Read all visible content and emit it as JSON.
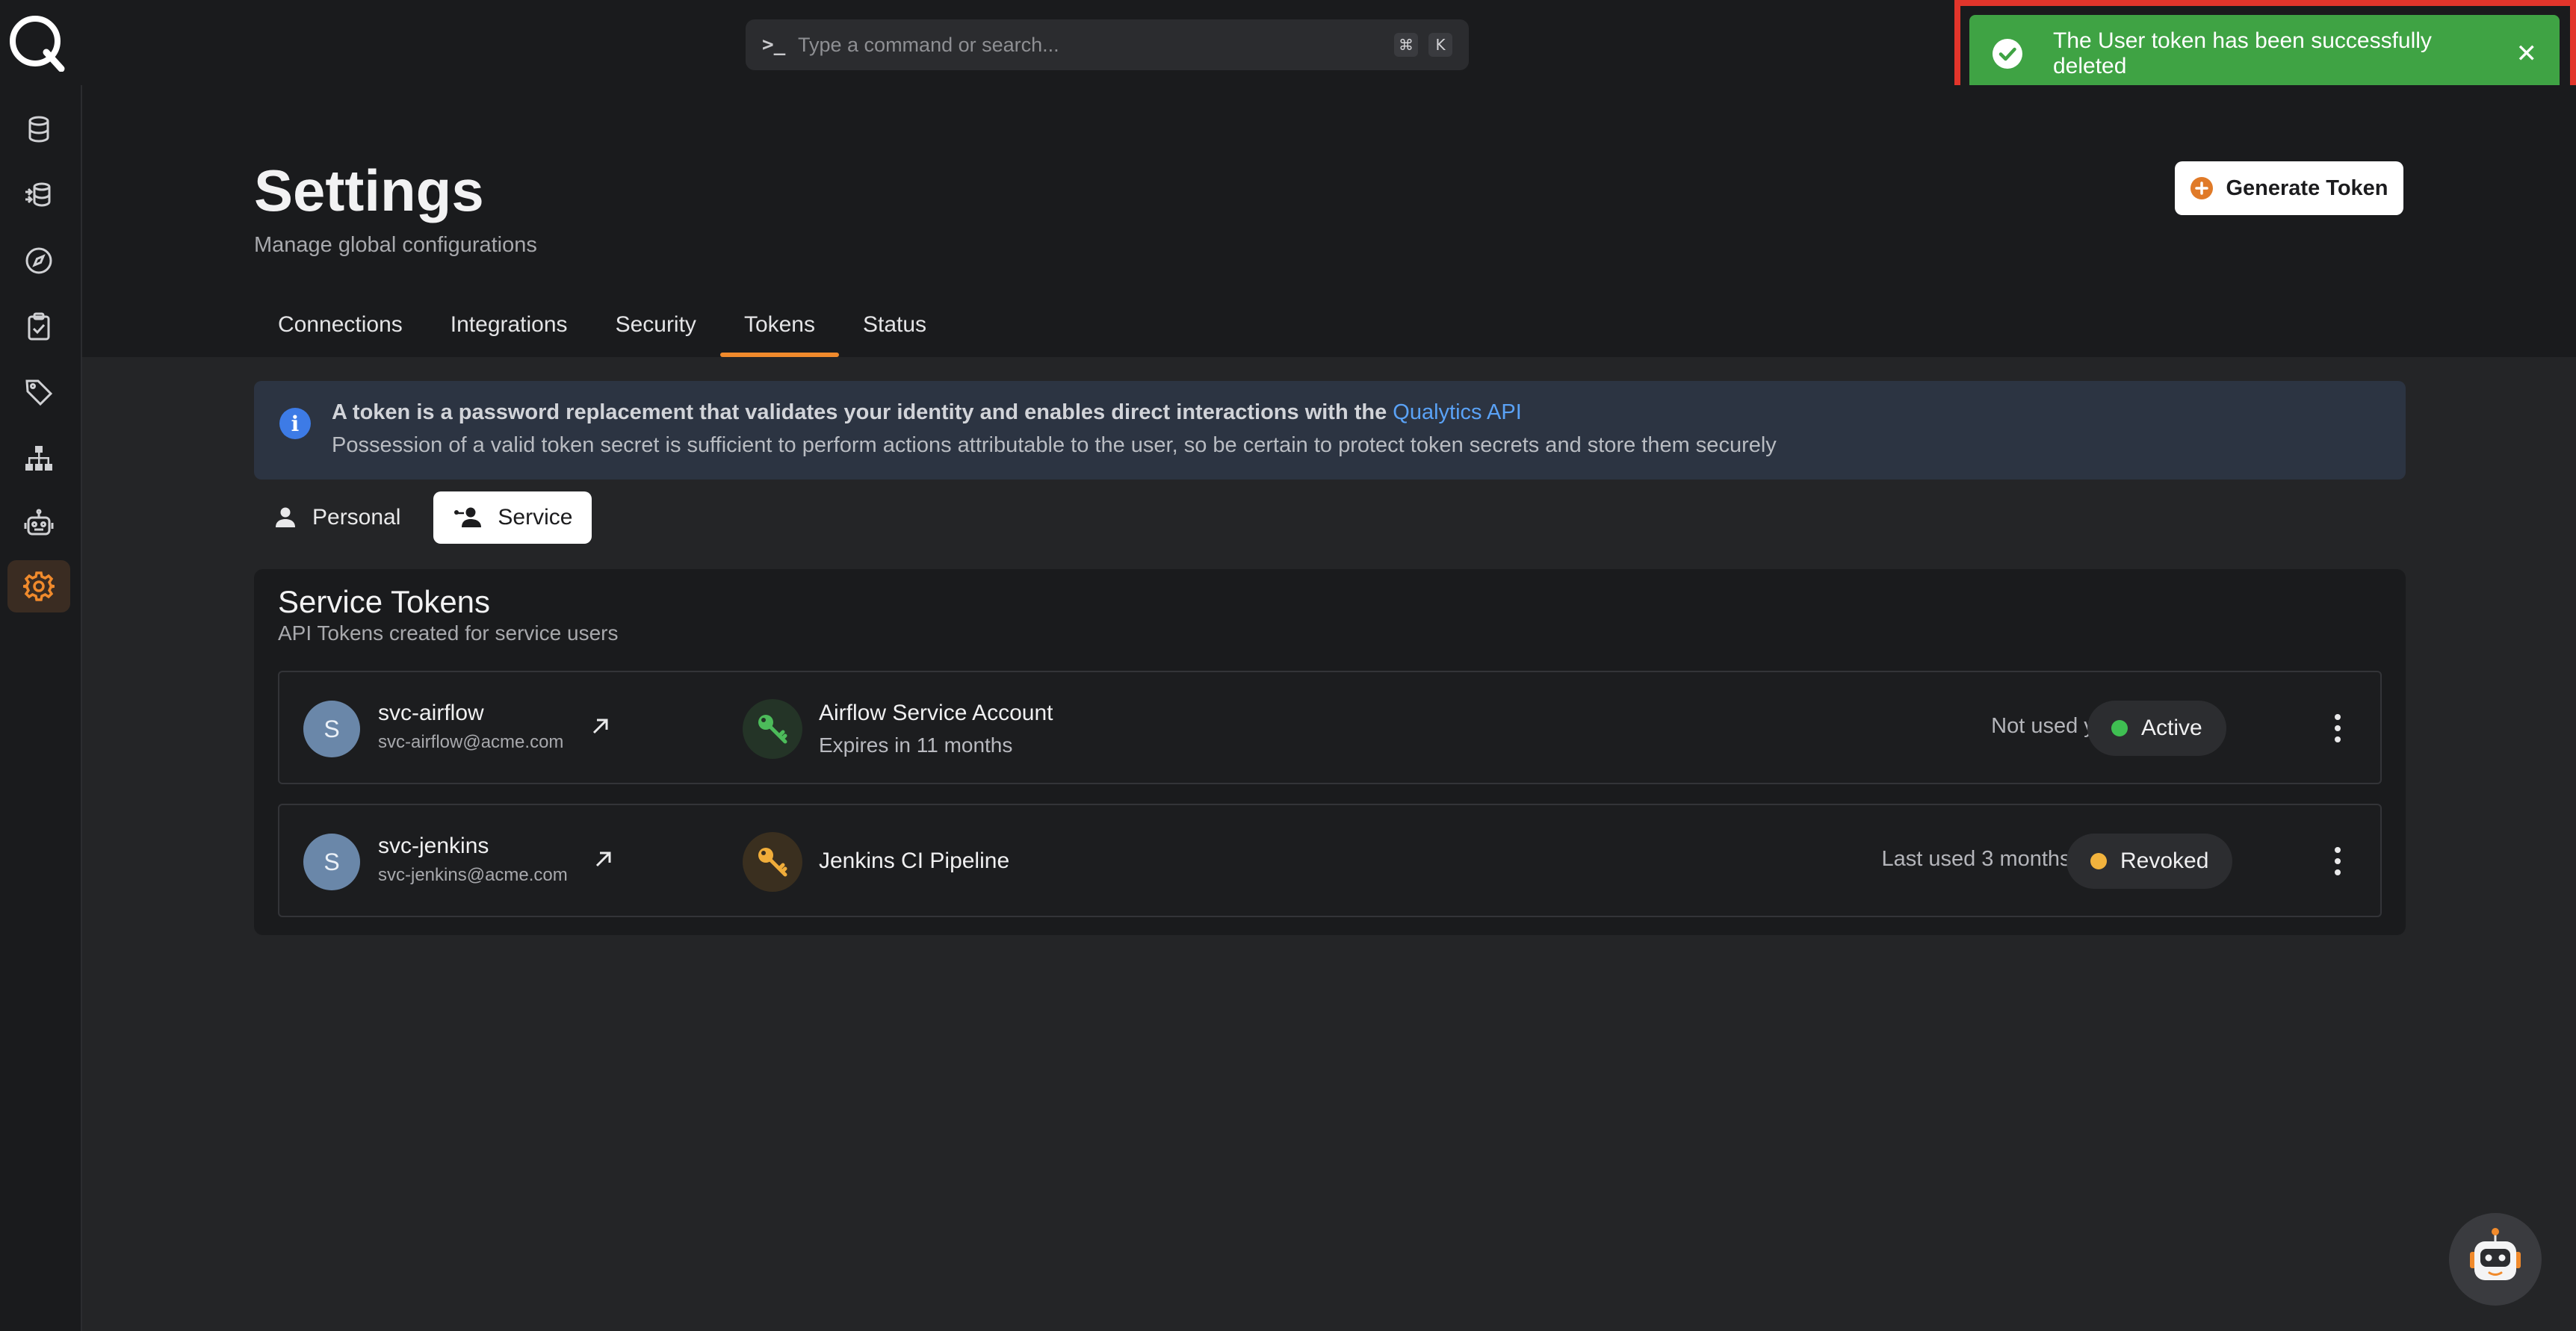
{
  "command_bar": {
    "placeholder": "Type a command or search...",
    "prompt_glyph": ">_",
    "shortcut_keys": [
      "⌘",
      "K"
    ]
  },
  "toast": {
    "message": "The User token has been successfully deleted",
    "close_glyph": "✕",
    "color": "#3fa344"
  },
  "sidebar": {
    "items": [
      {
        "icon": "database-icon"
      },
      {
        "icon": "data-flow-icon"
      },
      {
        "icon": "compass-icon"
      },
      {
        "icon": "clipboard-check-icon"
      },
      {
        "icon": "tag-icon"
      },
      {
        "icon": "hierarchy-icon"
      },
      {
        "icon": "robot-icon"
      },
      {
        "icon": "gear-icon",
        "active": true
      }
    ]
  },
  "header": {
    "title": "Settings",
    "subtitle": "Manage global configurations",
    "generate_button": "Generate Token",
    "tabs": [
      {
        "label": "Connections"
      },
      {
        "label": "Integrations"
      },
      {
        "label": "Security"
      },
      {
        "label": "Tokens",
        "active": true
      },
      {
        "label": "Status"
      }
    ]
  },
  "info_banner": {
    "line1": "A token is a password replacement that validates your identity and enables direct interactions with the ",
    "link": "Qualytics API",
    "line2": "Possession of a valid token secret is sufficient to perform actions attributable to the user, so be certain to protect token secrets and store them securely"
  },
  "segment": {
    "personal": "Personal",
    "service": "Service",
    "active": "Service"
  },
  "card": {
    "title": "Service Tokens",
    "subtitle": "API Tokens created for service users",
    "rows": [
      {
        "avatar": "S",
        "user": "svc-airflow",
        "email": "svc-airflow@acme.com",
        "token_name": "Airflow Service Account",
        "expires": "Expires in 11 months",
        "last_used": "Not used yet",
        "status": "Active",
        "status_color": "#3fbf52",
        "key_color": "#4cbb5a"
      },
      {
        "avatar": "S",
        "user": "svc-jenkins",
        "email": "svc-jenkins@acme.com",
        "token_name": "Jenkins CI Pipeline",
        "expires": "",
        "last_used": "Last used 3 months ago",
        "status": "Revoked",
        "status_color": "#f2b33d",
        "key_color": "#f0ad3a"
      }
    ]
  },
  "colors": {
    "accent": "#f08a2c",
    "link": "#5aa2f6"
  }
}
